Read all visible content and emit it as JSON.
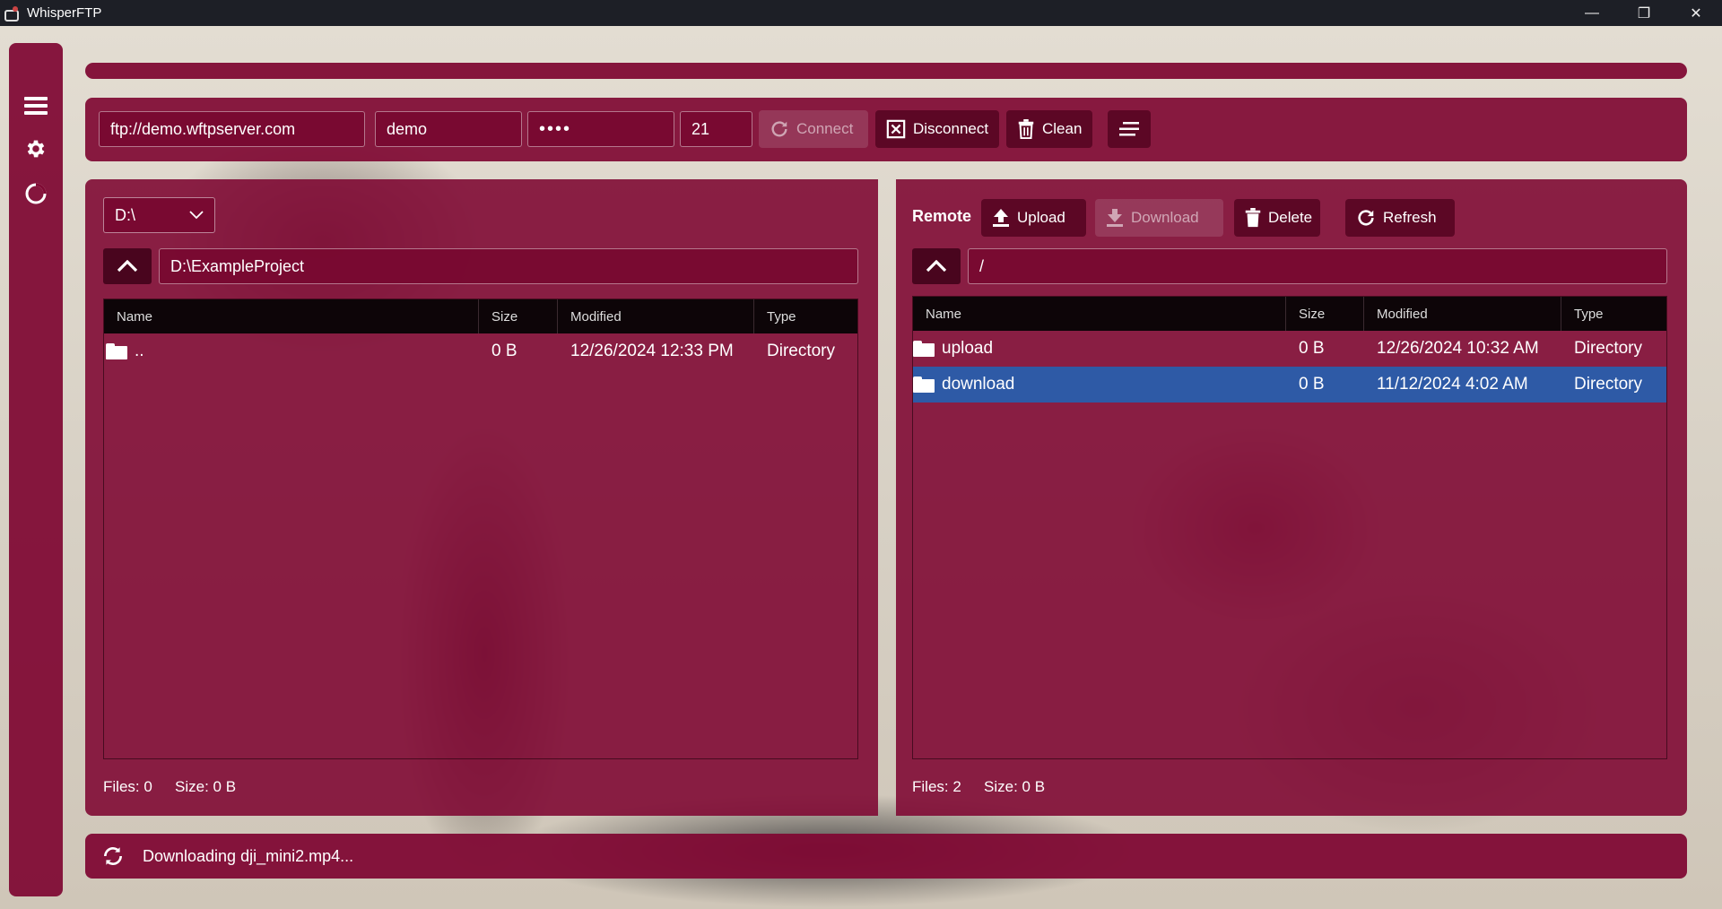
{
  "window": {
    "title": "WhisperFTP",
    "minimize": "—",
    "restore": "❐",
    "close": "✕"
  },
  "sidebar": {
    "items": [
      "menu-icon",
      "gear-icon",
      "loading-icon"
    ]
  },
  "progress": {
    "fraction": 0.0
  },
  "connection": {
    "host": "ftp://demo.wftpserver.com",
    "username": "demo",
    "password": "••••",
    "port": "21",
    "connect_label": "Connect",
    "disconnect_label": "Disconnect",
    "clean_label": "Clean"
  },
  "local": {
    "drive": "D:\\",
    "path": "D:\\ExampleProject",
    "columns": [
      "Name",
      "Size",
      "Modified",
      "Type"
    ],
    "rows": [
      {
        "name": "..",
        "size": "0 B",
        "modified": "12/26/2024 12:33 PM",
        "type": "Directory"
      }
    ],
    "files_label": "Files: 0",
    "size_label": "Size: 0 B"
  },
  "remote": {
    "label": "Remote",
    "upload_label": "Upload",
    "download_label": "Download",
    "delete_label": "Delete",
    "refresh_label": "Refresh",
    "path": "/",
    "columns": [
      "Name",
      "Size",
      "Modified",
      "Type"
    ],
    "rows": [
      {
        "name": "upload",
        "size": "0 B",
        "modified": "12/26/2024 10:32 AM",
        "type": "Directory",
        "selected": false
      },
      {
        "name": "download",
        "size": "0 B",
        "modified": "11/12/2024 4:02 AM",
        "type": "Directory",
        "selected": true
      }
    ],
    "files_label": "Files: 2",
    "size_label": "Size: 0 B"
  },
  "status": {
    "message": "Downloading dji_mini2.mp4..."
  },
  "colors": {
    "accent": "#800a34",
    "selection": "#2e5aa6",
    "titlebar": "#1d1f26"
  }
}
